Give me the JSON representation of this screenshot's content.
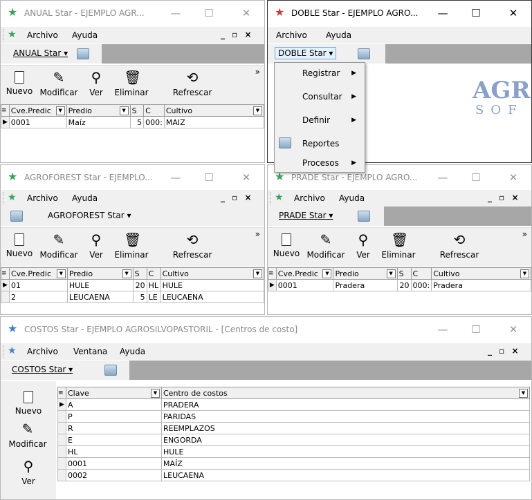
{
  "colors": {
    "star": "#3aa35a",
    "toolbar_dark": "#a7a7a7",
    "menubar": "#f0f0f0"
  },
  "common": {
    "menu_archivo": "Archivo",
    "menu_ayuda": "Ayuda",
    "menu_ventana": "Ventana",
    "mdi_controls": "_ ▫ ×",
    "btn_nuevo": "Nuevo",
    "btn_modificar": "Modificar",
    "btn_ver": "Ver",
    "btn_eliminar": "Eliminar",
    "btn_refrescar": "Refrescar",
    "overflow": "»",
    "min": "—",
    "max": "☐",
    "close": "✕"
  },
  "anual": {
    "title": "ANUAL Star - EJEMPLO AGR...",
    "toolbar_label": "ANUAL Star ▾",
    "headers": [
      "Cve.Predic",
      "Predio",
      "S",
      "C",
      "Cultivo"
    ],
    "rows": [
      [
        "0001",
        "Maíz",
        "5",
        "000:",
        "MAIZ"
      ]
    ]
  },
  "doble": {
    "title": "DOBLE Star - EJEMPLO AGRO...",
    "toolbar_label": "DOBLE Star ▾",
    "logo_top": "AGR",
    "logo_bottom": "SOF",
    "menu": [
      "Registrar",
      "Consultar",
      "Definir",
      "Reportes",
      "Procesos"
    ]
  },
  "agroforest": {
    "title": "AGROFOREST Star - EJEMPLO...",
    "toolbar_label": "AGROFOREST Star ▾",
    "headers": [
      "Cve.Predic",
      "Predio",
      "S",
      "C",
      "Cultivo"
    ],
    "rows": [
      [
        "01",
        "HULE",
        "20",
        "HL",
        "HULE"
      ],
      [
        "2",
        "LEUCAENA",
        "5",
        "LE",
        "LEUCAENA"
      ]
    ]
  },
  "prade": {
    "title": "PRADE Star - EJEMPLO AGRO...",
    "toolbar_label": "PRADE Star ▾",
    "headers": [
      "Cve.Predic",
      "Predio",
      "S",
      "C",
      "Cultivo"
    ],
    "rows": [
      [
        "0001",
        "Pradera",
        "20",
        "000:",
        "Pradera"
      ]
    ]
  },
  "costos": {
    "title": "COSTOS Star - EJEMPLO AGROSILVOPASTORIL - [Centros de costo]",
    "toolbar_label": "COSTOS Star ▾",
    "headers": [
      "Clave",
      "Centro de costos"
    ],
    "rows": [
      [
        "A",
        "PRADERA"
      ],
      [
        "P",
        "PARIDAS"
      ],
      [
        "R",
        "REEMPLAZOS"
      ],
      [
        "E",
        "ENGORDA"
      ],
      [
        "HL",
        "HULE"
      ],
      [
        "0001",
        "MAÍZ"
      ],
      [
        "0002",
        "LEUCAENA"
      ]
    ]
  }
}
